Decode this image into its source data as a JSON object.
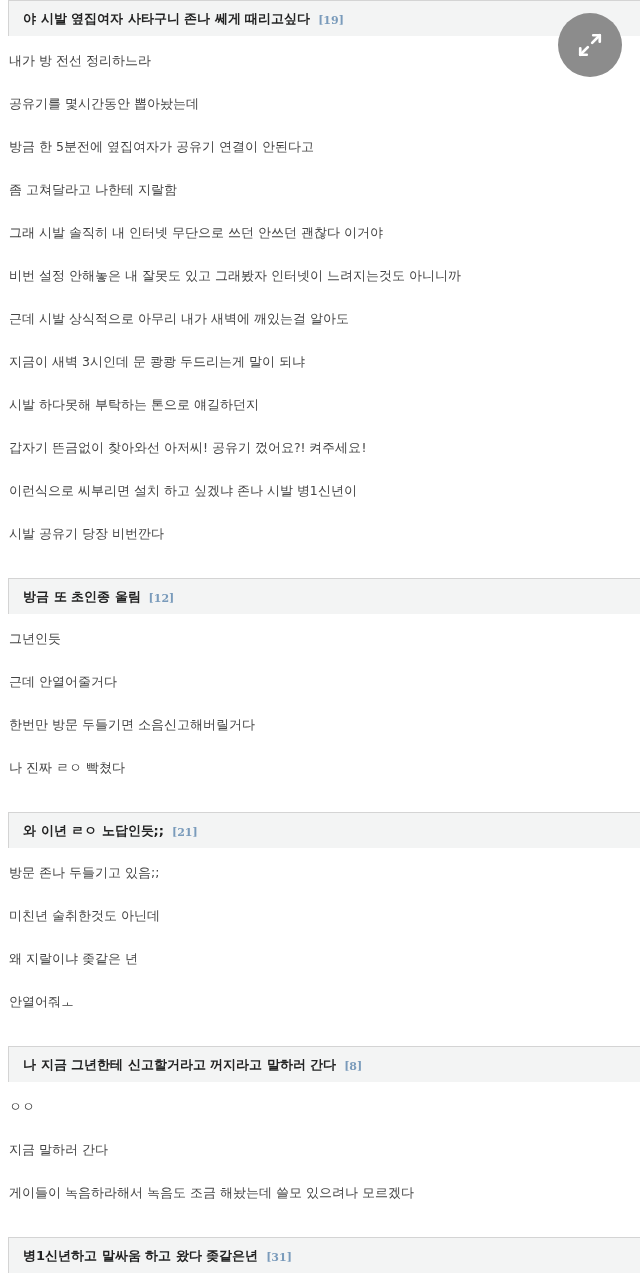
{
  "posts": [
    {
      "title": "야 시발 옆집여자 사타구니 존나 쎄게 때리고싶다",
      "count": "[19]",
      "lines": [
        "내가 방 전선 정리하느라",
        "공유기를 몇시간동안 뽑아놨는데",
        "방금 한 5분전에 옆집여자가 공유기 연결이 안된다고",
        "좀 고쳐달라고 나한테 지랄함",
        "그래 시발 솔직히 내 인터넷 무단으로 쓰던 안쓰던 괜찮다 이거야",
        "비번 설정 안해놓은 내 잘못도 있고 그래봤자 인터넷이 느려지는것도 아니니까",
        "근데 시발 상식적으로 아무리 내가 새벽에 깨있는걸 알아도",
        "지금이 새벽 3시인데 문 쾅쾅 두드리는게 말이 되냐",
        "시발 하다못해 부탁하는 톤으로 얘길하던지",
        "갑자기 뜬금없이 찾아와선 아저씨! 공유기 껐어요?! 켜주세요!",
        "이런식으로 씨부리면 설치 하고 싶겠냐 존나 시발 병1신년이",
        "시발 공유기 당장 비번깐다"
      ]
    },
    {
      "title": "방금 또 초인종 울림",
      "count": "[12]",
      "lines": [
        "그년인듯",
        "근데 안열어줄거다",
        "한번만 방문 두들기면 소음신고해버릴거다",
        "나 진짜 ㄹㅇ 빡쳤다"
      ]
    },
    {
      "title": "와 이년 ㄹㅇ 노답인듯;;",
      "count": "[21]",
      "lines": [
        "방문 존나 두들기고 있음;;",
        "미친년 술취한것도 아닌데",
        "왜 지랄이냐 좆같은 년",
        "안열어줘ㅗ"
      ]
    },
    {
      "title": "나 지금 그년한테 신고할거라고 꺼지라고 말하러 간다",
      "count": "[8]",
      "lines": [
        "ㅇㅇ",
        "지금 말하러 간다",
        "게이들이 녹음하라해서 녹음도 조금 해놨는데 쓸모 있으려나 모르겠다"
      ]
    },
    {
      "title": "병1신년하고 말싸움 하고 왔다 좆같은년",
      "count": "[31]"
    }
  ]
}
